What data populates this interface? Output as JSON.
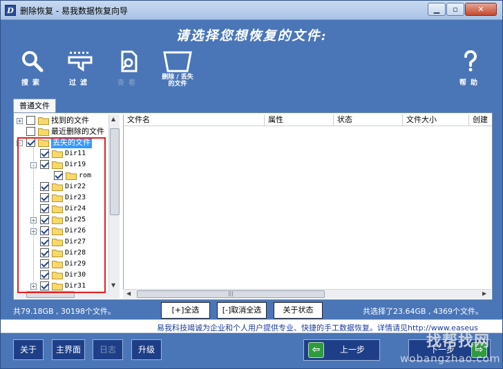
{
  "window": {
    "title": "删除恢复 - 易我数据恢复向导",
    "app_icon_letter": "D",
    "controls": [
      "minimize",
      "maximize",
      "close"
    ]
  },
  "header": {
    "title": "请选择您想恢复的文件:",
    "tools": [
      {
        "label": "搜索",
        "icon": "search-icon",
        "enabled": true
      },
      {
        "label": "过滤",
        "icon": "filter-icon",
        "enabled": true
      },
      {
        "label": "查看",
        "icon": "preview-icon",
        "enabled": false
      },
      {
        "label_line1": "删除 / 丢失",
        "label_line2": "的文件",
        "icon": "deleted-files-icon",
        "enabled": true
      },
      {
        "label": "帮助",
        "icon": "help-icon",
        "enabled": true
      }
    ]
  },
  "tabs": [
    {
      "label": "普通文件",
      "active": true
    }
  ],
  "tree": {
    "items": [
      {
        "label": "找到的文件",
        "checked": false,
        "expander": "+",
        "level": 0
      },
      {
        "label": "最近删除的文件",
        "checked": false,
        "expander": "",
        "level": 0
      },
      {
        "label": "丢失的文件",
        "checked": true,
        "expander": "-",
        "level": 0,
        "selected": true
      },
      {
        "label": "Dir11",
        "checked": true,
        "expander": "",
        "level": 1
      },
      {
        "label": "Dir19",
        "checked": true,
        "expander": "-",
        "level": 1
      },
      {
        "label": "rom",
        "checked": true,
        "expander": "",
        "level": 2
      },
      {
        "label": "Dir22",
        "checked": true,
        "expander": "",
        "level": 1
      },
      {
        "label": "Dir23",
        "checked": true,
        "expander": "",
        "level": 1
      },
      {
        "label": "Dir24",
        "checked": true,
        "expander": "",
        "level": 1
      },
      {
        "label": "Dir25",
        "checked": true,
        "expander": "+",
        "level": 1
      },
      {
        "label": "Dir26",
        "checked": true,
        "expander": "+",
        "level": 1
      },
      {
        "label": "Dir27",
        "checked": true,
        "expander": "",
        "level": 1
      },
      {
        "label": "Dir28",
        "checked": true,
        "expander": "",
        "level": 1
      },
      {
        "label": "Dir29",
        "checked": true,
        "expander": "",
        "level": 1
      },
      {
        "label": "Dir30",
        "checked": true,
        "expander": "",
        "level": 1
      },
      {
        "label": "Dir31",
        "checked": true,
        "expander": "+",
        "level": 1
      }
    ]
  },
  "file_list": {
    "columns": [
      "文件名",
      "属性",
      "状态",
      "文件大小",
      "创建"
    ]
  },
  "summary": {
    "total": "共79.18GB , 30198个文件。",
    "selected": "共选择了23.64GB , 4369个文件。"
  },
  "actions": {
    "select_all": "[+]全选",
    "deselect_all": "[-]取消全选",
    "about_status": "关于状态"
  },
  "promo": "易我科技竭诚为企业和个人用户提供专业、快捷的手工数据恢复。详情请见http://www.easeus",
  "footer": {
    "about": "关于",
    "main": "主界面",
    "log": "日志",
    "upgrade": "升级",
    "prev": "上一步",
    "next": "下一步"
  },
  "watermark": {
    "line1": "找帮找网",
    "line2": "wobangzhao.com"
  },
  "colors": {
    "background": "#4a76b8",
    "button_bg": "#1e3f88",
    "selection": "#3399ff",
    "highlight_box": "#e02020",
    "arrow_green": "#2e9b3c"
  }
}
